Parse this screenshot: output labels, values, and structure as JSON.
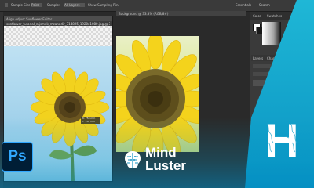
{
  "options_bar": {
    "items": [
      "Sample Size:",
      "Point",
      "Sample:",
      "All Layers",
      "Show Sampling Ring"
    ],
    "extra_items": [
      "Essentials",
      "Search"
    ]
  },
  "doc_left": {
    "tab_title": "Align Adjust Sunflower Editor",
    "title": "sunflower_tutorial_mjsmdk_mcanadir_714895_1920x1080.jpg @ 33.3% (RGB/8)",
    "measure_values": [
      "W: 750 mm",
      "H: 750 mm"
    ]
  },
  "doc_right": {
    "title": "Background @ 33.3% (RGB/8#)"
  },
  "panels": {
    "tab_color": "Color",
    "tab_swatches": "Swatches",
    "tab_layers": "Layers",
    "tab_channels": "Channels",
    "tab_paths": "Paths"
  },
  "brand": {
    "ps_label": "Ps",
    "mind_line1": "Mind",
    "mind_line2": "Luster",
    "h_letter": "H"
  },
  "colors": {
    "teal": "#00a3cc",
    "ps_blue": "#31a8ff",
    "ps_dark": "#001e36"
  }
}
